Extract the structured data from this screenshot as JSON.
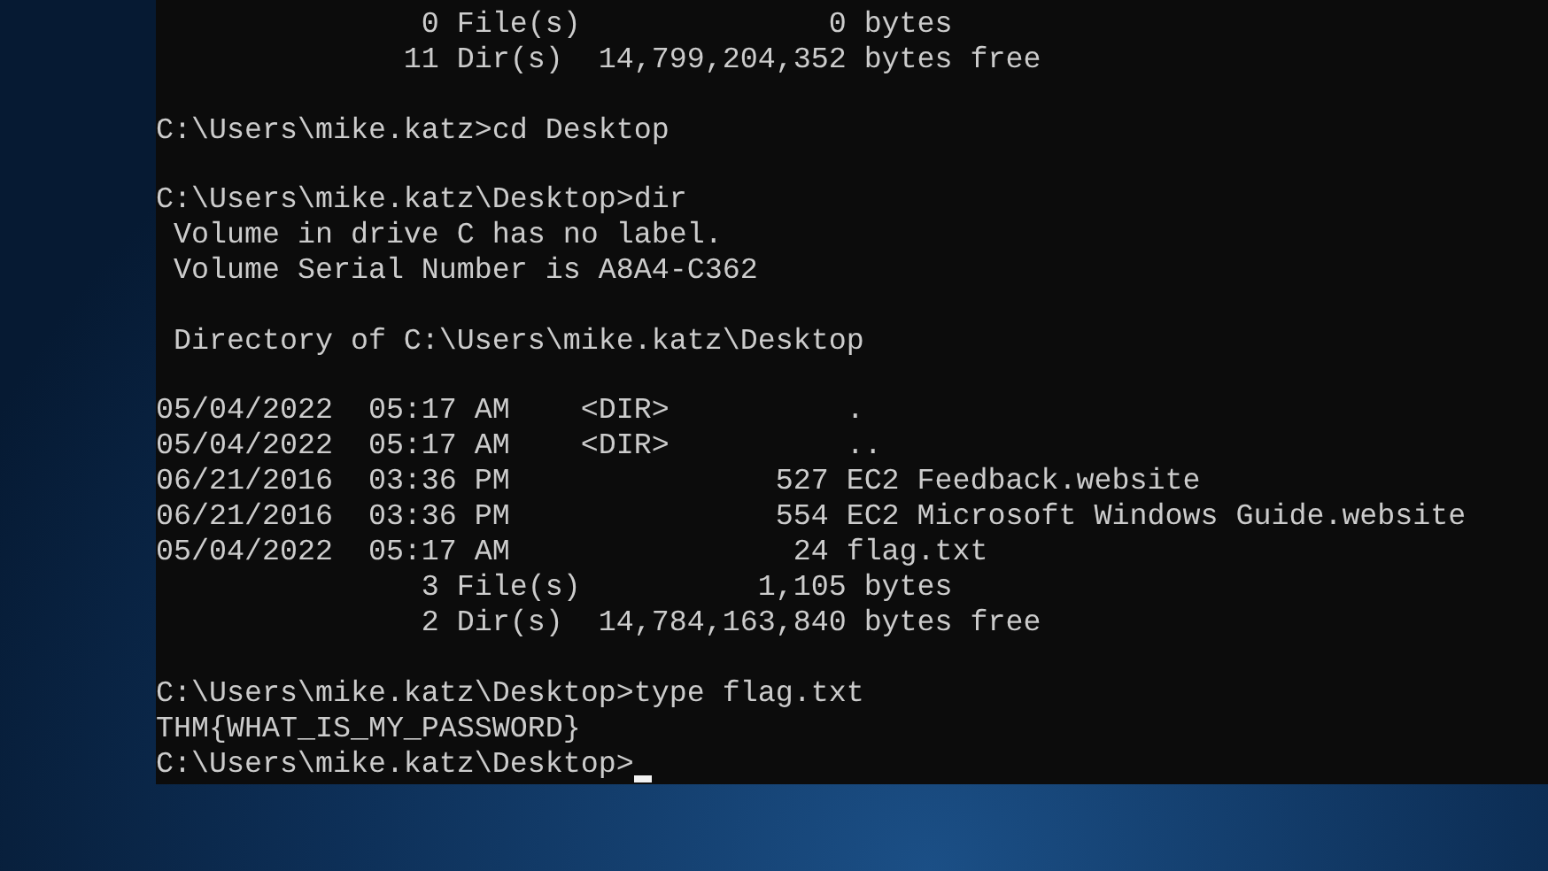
{
  "terminal": {
    "lines": [
      {
        "kind": "text",
        "text": "               0 File(s)              0 bytes"
      },
      {
        "kind": "text",
        "text": "              11 Dir(s)  14,799,204,352 bytes free"
      },
      {
        "kind": "blank"
      },
      {
        "kind": "text",
        "text": "C:\\Users\\mike.katz>cd Desktop"
      },
      {
        "kind": "blank"
      },
      {
        "kind": "text",
        "text": "C:\\Users\\mike.katz\\Desktop>dir"
      },
      {
        "kind": "text",
        "text": " Volume in drive C has no label."
      },
      {
        "kind": "text",
        "text": " Volume Serial Number is A8A4-C362"
      },
      {
        "kind": "blank"
      },
      {
        "kind": "text",
        "text": " Directory of C:\\Users\\mike.katz\\Desktop"
      },
      {
        "kind": "blank"
      },
      {
        "kind": "text",
        "text": "05/04/2022  05:17 AM    <DIR>          ."
      },
      {
        "kind": "text",
        "text": "05/04/2022  05:17 AM    <DIR>          .."
      },
      {
        "kind": "text",
        "text": "06/21/2016  03:36 PM               527 EC2 Feedback.website"
      },
      {
        "kind": "text",
        "text": "06/21/2016  03:36 PM               554 EC2 Microsoft Windows Guide.website"
      },
      {
        "kind": "text",
        "text": "05/04/2022  05:17 AM                24 flag.txt"
      },
      {
        "kind": "text",
        "text": "               3 File(s)          1,105 bytes"
      },
      {
        "kind": "text",
        "text": "               2 Dir(s)  14,784,163,840 bytes free"
      },
      {
        "kind": "blank"
      },
      {
        "kind": "text",
        "text": "C:\\Users\\mike.katz\\Desktop>type flag.txt"
      },
      {
        "kind": "text",
        "text": "THM{WHAT_IS_MY_PASSWORD}"
      },
      {
        "kind": "prompt",
        "text": "C:\\Users\\mike.katz\\Desktop>",
        "cursor": true
      }
    ]
  }
}
